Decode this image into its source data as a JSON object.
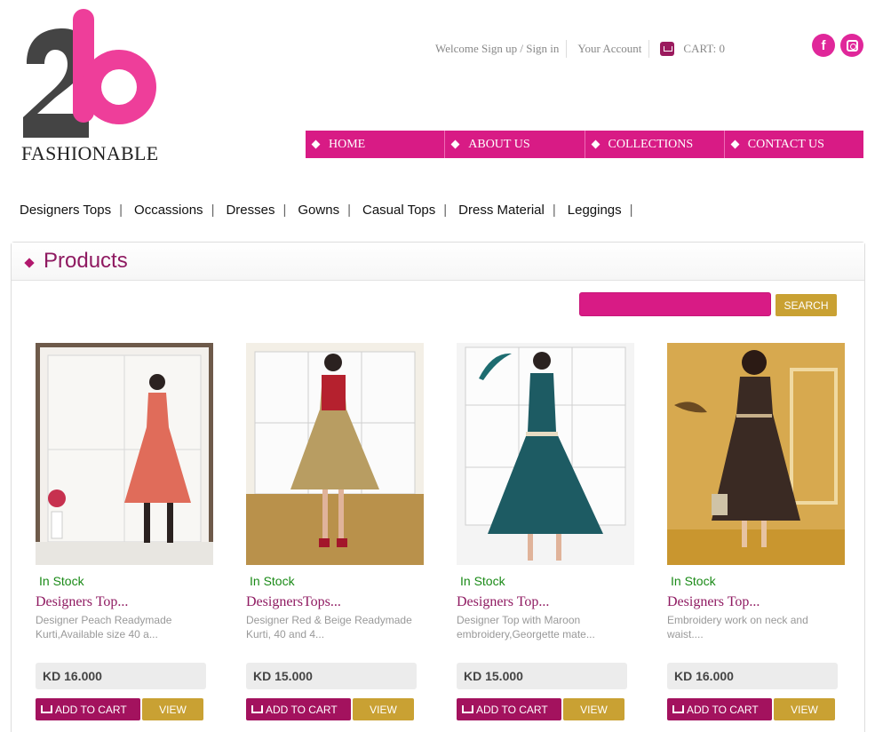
{
  "brand": {
    "logo_text": "FASHIONABLE",
    "accent": "#d81b85",
    "dark": "#444444",
    "gold": "#c9a133"
  },
  "header": {
    "welcome": "Welcome Sign up / Sign in",
    "account": "Your Account",
    "cart": "CART: 0",
    "social": [
      {
        "name": "facebook-icon",
        "glyph": "f"
      },
      {
        "name": "instagram-icon",
        "glyph": ""
      }
    ]
  },
  "nav": [
    "HOME",
    "ABOUT US",
    "COLLECTIONS",
    "CONTACT US"
  ],
  "categories": [
    "Designers Tops",
    "Occassions",
    "Dresses",
    "Gowns",
    "Casual Tops",
    "Dress Material",
    "Leggings"
  ],
  "products_section": {
    "title": "Products",
    "search_button": "SEARCH",
    "search_value": ""
  },
  "products": [
    {
      "stock": "In Stock",
      "name": "Designers Top...",
      "desc": "Designer Peach Readymade Kurti,Available size 40 a...",
      "price": "KD 16.000",
      "add": "ADD TO CART",
      "view": "VIEW",
      "dress_color": "#e06c5a",
      "bg": "#efefef"
    },
    {
      "stock": "In Stock",
      "name": "DesignersTops...",
      "desc": "Designer Red & Beige Readymade Kurti, 40 and 4...",
      "price": "KD 15.000",
      "add": "ADD TO CART",
      "view": "VIEW",
      "dress_color": "#b89d62",
      "bg": "#f3efe6"
    },
    {
      "stock": "In Stock",
      "name": "Designers Top...",
      "desc": "Designer Top with Maroon embroidery,Georgette mate...",
      "price": "KD 15.000",
      "add": "ADD TO CART",
      "view": "VIEW",
      "dress_color": "#1d5b63",
      "bg": "#f2f2f2"
    },
    {
      "stock": "In Stock",
      "name": "Designers Top...",
      "desc": "Embroidery work on neck and waist....",
      "price": "KD 16.000",
      "add": "ADD TO CART",
      "view": "VIEW",
      "dress_color": "#3a2a23",
      "bg": "#d7a94f"
    }
  ]
}
